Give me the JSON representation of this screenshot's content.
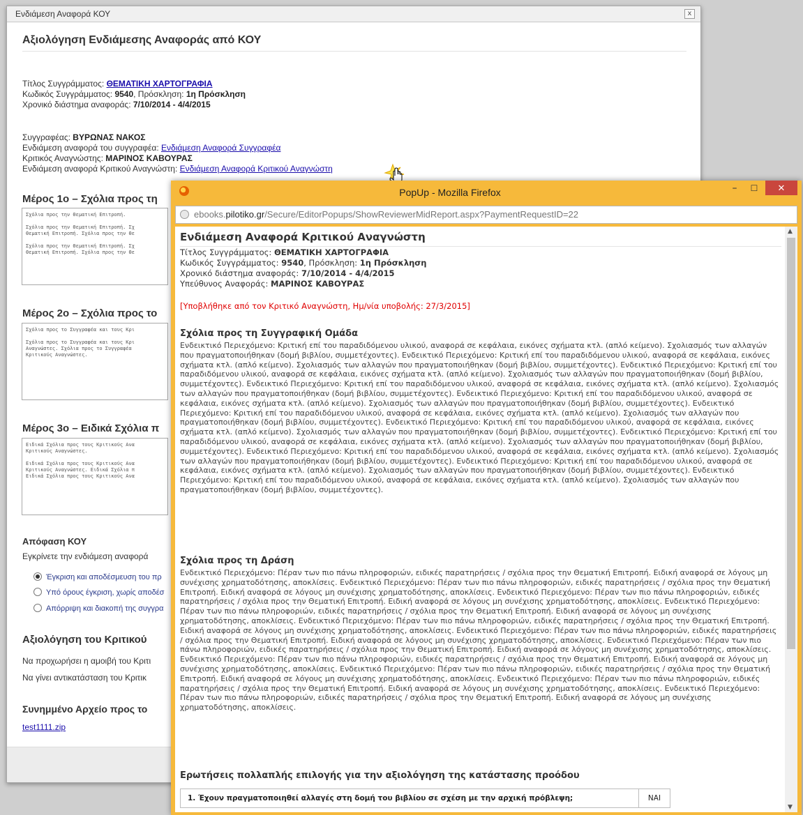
{
  "dialog": {
    "title": "Ενδιάμεση Αναφορά ΚΟΥ",
    "close": "x",
    "heading": "Αξιολόγηση Ενδιάμεσης Αναφοράς από ΚΟΥ",
    "book_title_label": "Τίτλος Συγγράμματος:",
    "book_title": "ΘΕΜΑΤΙΚΗ ΧΑΡΤΟΓΡΑΦΙΑ",
    "code_label": "Κωδικός Συγγράμματος:",
    "code": "9540",
    "call_label": ", Πρόσκληση:",
    "call": "1η Πρόσκληση",
    "period_label": "Χρονικό διάστημα αναφοράς:",
    "period": "7/10/2014 - 4/4/2015",
    "author_label": "Συγγραφέας:",
    "author": "ΒΥΡΩΝΑΣ ΝΑΚΟΣ",
    "author_report_label": "Ενδιάμεση αναφορά του συγγραφέα:",
    "author_report_link": "Ενδιάμεση Αναφορά Συγγραφέα",
    "reviewer_label": "Κριτικός Αναγνώστης:",
    "reviewer": "ΜΑΡΙΝΟΣ ΚΑΒΟΥΡΑΣ",
    "reviewer_report_label": "Ενδιάμεση αναφορά Κριτικού Αναγνώστη:",
    "reviewer_report_link": "Ενδιάμεση Αναφορά Κριτικού Αναγνώστη",
    "part1_title": "Μέρος 1ο – Σχόλια προς τη",
    "part1_text": "Σχόλια προς την Θεματική Επιτροπή.\n\nΣχόλια προς την Θεματική Επιτροπή. Σχ\nΘεματική Επιτροπή. Σχόλια προς την Θε\n\nΣχόλια προς την Θεματική Επιτροπή. Σχ\nΘεματική Επιτροπή. Σχόλια προς την Θε",
    "part2_title": "Μέρος 2ο – Σχόλια προς το",
    "part2_text": "Σχόλια προς το Συγγραφέα και τους Κρι\n\nΣχόλια προς το Συγγραφέα και τους Κρι\nΑναγνώστες. Σχόλια προς το Συγγραφέα \nΚριτικούς Αναγνώστες.",
    "part3_title": "Μέρος 3ο – Ειδικά Σχόλια π",
    "part3_text": "Ειδικά Σχόλια προς τους Κριτικούς Ανα\nΚριτικούς Αναγνώστες.\n\nΕιδικά Σχόλια προς τους Κριτικούς Ανα\nΚριτικούς Αναγνώστες. Ειδικά Σχόλια π\nΕιδικά Σχόλια προς τους Κριτικούς Ανα",
    "decision_title": "Απόφαση ΚΟΥ",
    "decision_question": "Εγκρίνετε την ενδιάμεση αναφορά",
    "radio1": "Έγκριση και αποδέσμευση του πρ",
    "radio2": "Υπό όρους έγκριση, χωρίς αποδέσ",
    "radio3": "Απόρριψη και διακοπή της συγγρα",
    "eval_title": "Αξιολόγηση του Κριτικού",
    "eval_line1": "Να προχωρήσει η αμοιβή του Κριτι",
    "eval_line2": "Να γίνει αντικατάσταση του Κριτικ",
    "attach_title": "Συνημμένο Αρχείο προς το",
    "attach_link": "test1111.zip"
  },
  "popup": {
    "window_title": "PopUp - Mozilla Firefox",
    "min": "–",
    "max": "☐",
    "close": "✕",
    "url_prefix": "ebooks.",
    "url_domain": "pilotiko.gr",
    "url_rest": "/Secure/EditorPopups/ShowReviewerMidReport.aspx?PaymentRequestID=22",
    "heading": "Ενδιάμεση Αναφορά Κριτικού Αναγνώστη",
    "title_label": "Τίτλος Συγγράμματος:",
    "title": "ΘΕΜΑΤΙΚΗ ΧΑΡΤΟΓΡΑΦΙΑ",
    "code_label": "Κωδικός Συγγράμματος:",
    "code": "9540",
    "call_label": ", Πρόσκληση:",
    "call": "1η Πρόσκληση",
    "period_label": "Χρονικό διάστημα αναφοράς:",
    "period": "7/10/2014 - 4/4/2015",
    "owner_label": "Υπεύθυνος Αναφοράς:",
    "owner": "ΜΑΡΙΝΟΣ ΚΑΒΟΥΡΑΣ",
    "submitted": "[Υποβλήθηκε από τον Κριτικό Αναγνώστη, Ημ/νία υποβολής: 27/3/2015]",
    "sec1_title": "Σχόλια προς τη Συγγραφική Ομάδα",
    "sec1_text": "Ενδεικτικό Περιεχόμενο: Κριτική επί του παραδιδόμενου υλικού, αναφορά σε κεφάλαια, εικόνες σχήματα κτλ. (απλό κείμενο). Σχολιασμός των αλλαγών που πραγματοποιήθηκαν (δομή βιβλίου, συμμετέχοντες). Ενδεικτικό Περιεχόμενο: Κριτική επί του παραδιδόμενου υλικού, αναφορά σε κεφάλαια, εικόνες σχήματα κτλ. (απλό κείμενο). Σχολιασμός των αλλαγών που πραγματοποιήθηκαν (δομή βιβλίου, συμμετέχοντες). Ενδεικτικό Περιεχόμενο: Κριτική επί του παραδιδόμενου υλικού, αναφορά σε κεφάλαια, εικόνες σχήματα κτλ. (απλό κείμενο). Σχολιασμός των αλλαγών που πραγματοποιήθηκαν (δομή βιβλίου, συμμετέχοντες). Ενδεικτικό Περιεχόμενο: Κριτική επί του παραδιδόμενου υλικού, αναφορά σε κεφάλαια, εικόνες σχήματα κτλ. (απλό κείμενο). Σχολιασμός των αλλαγών που πραγματοποιήθηκαν (δομή βιβλίου, συμμετέχοντες). Ενδεικτικό Περιεχόμενο: Κριτική επί του παραδιδόμενου υλικού, αναφορά σε κεφάλαια, εικόνες σχήματα κτλ. (απλό κείμενο). Σχολιασμός των αλλαγών που πραγματοποιήθηκαν (δομή βιβλίου, συμμετέχοντες). Ενδεικτικό Περιεχόμενο: Κριτική επί του παραδιδόμενου υλικού, αναφορά σε κεφάλαια, εικόνες σχήματα κτλ. (απλό κείμενο). Σχολιασμός των αλλαγών που πραγματοποιήθηκαν (δομή βιβλίου, συμμετέχοντες). Ενδεικτικό Περιεχόμενο: Κριτική επί του παραδιδόμενου υλικού, αναφορά σε κεφάλαια, εικόνες σχήματα κτλ. (απλό κείμενο). Σχολιασμός των αλλαγών που πραγματοποιήθηκαν (δομή βιβλίου, συμμετέχοντες). Ενδεικτικό Περιεχόμενο: Κριτική επί του παραδιδόμενου υλικού, αναφορά σε κεφάλαια, εικόνες σχήματα κτλ. (απλό κείμενο). Σχολιασμός των αλλαγών που πραγματοποιήθηκαν (δομή βιβλίου, συμμετέχοντες). Ενδεικτικό Περιεχόμενο: Κριτική επί του παραδιδόμενου υλικού, αναφορά σε κεφάλαια, εικόνες σχήματα κτλ. (απλό κείμενο). Σχολιασμός των αλλαγών που πραγματοποιήθηκαν (δομή βιβλίου, συμμετέχοντες). Ενδεικτικό Περιεχόμενο: Κριτική επί του παραδιδόμενου υλικού, αναφορά σε κεφάλαια, εικόνες σχήματα κτλ. (απλό κείμενο). Σχολιασμός των αλλαγών που πραγματοποιήθηκαν (δομή βιβλίου, συμμετέχοντες). Ενδεικτικό Περιεχόμενο: Κριτική επί του παραδιδόμενου υλικού, αναφορά σε κεφάλαια, εικόνες σχήματα κτλ. (απλό κείμενο). Σχολιασμός των αλλαγών που πραγματοποιήθηκαν (δομή βιβλίου, συμμετέχοντες).",
    "sec2_title": "Σχόλια προς τη Δράση",
    "sec2_text": "Ενδεικτικό Περιεχόμενο: Πέραν των πιο πάνω πληροφοριών, ειδικές παρατηρήσεις / σχόλια προς την Θεματική Επιτροπή. Ειδική αναφορά σε λόγους μη συνέχισης χρηματοδότησης, αποκλίσεις. Ενδεικτικό Περιεχόμενο: Πέραν των πιο πάνω πληροφοριών, ειδικές παρατηρήσεις / σχόλια προς την Θεματική Επιτροπή. Ειδική αναφορά σε λόγους μη συνέχισης χρηματοδότησης, αποκλίσεις. Ενδεικτικό Περιεχόμενο: Πέραν των πιο πάνω πληροφοριών, ειδικές παρατηρήσεις / σχόλια προς την Θεματική Επιτροπή. Ειδική αναφορά σε λόγους μη συνέχισης χρηματοδότησης, αποκλίσεις. Ενδεικτικό Περιεχόμενο: Πέραν των πιο πάνω πληροφοριών, ειδικές παρατηρήσεις / σχόλια προς την Θεματική Επιτροπή. Ειδική αναφορά σε λόγους μη συνέχισης χρηματοδότησης, αποκλίσεις. Ενδεικτικό Περιεχόμενο: Πέραν των πιο πάνω πληροφοριών, ειδικές παρατηρήσεις / σχόλια προς την Θεματική Επιτροπή. Ειδική αναφορά σε λόγους μη συνέχισης χρηματοδότησης, αποκλίσεις. Ενδεικτικό Περιεχόμενο: Πέραν των πιο πάνω πληροφοριών, ειδικές παρατηρήσεις / σχόλια προς την Θεματική Επιτροπή. Ειδική αναφορά σε λόγους μη συνέχισης χρηματοδότησης, αποκλίσεις. Ενδεικτικό Περιεχόμενο: Πέραν των πιο πάνω πληροφοριών, ειδικές παρατηρήσεις / σχόλια προς την Θεματική Επιτροπή. Ειδική αναφορά σε λόγους μη συνέχισης χρηματοδότησης, αποκλίσεις. Ενδεικτικό Περιεχόμενο: Πέραν των πιο πάνω πληροφοριών, ειδικές παρατηρήσεις / σχόλια προς την Θεματική Επιτροπή. Ειδική αναφορά σε λόγους μη συνέχισης χρηματοδότησης, αποκλίσεις. Ενδεικτικό Περιεχόμενο: Πέραν των πιο πάνω πληροφοριών, ειδικές παρατηρήσεις / σχόλια προς την Θεματική Επιτροπή. Ειδική αναφορά σε λόγους μη συνέχισης χρηματοδότησης, αποκλίσεις. Ενδεικτικό Περιεχόμενο: Πέραν των πιο πάνω πληροφοριών, ειδικές παρατηρήσεις / σχόλια προς την Θεματική Επιτροπή. Ειδική αναφορά σε λόγους μη συνέχισης χρηματοδότησης, αποκλίσεις. Ενδεικτικό Περιεχόμενο: Πέραν των πιο πάνω πληροφοριών, ειδικές παρατηρήσεις / σχόλια προς την Θεματική Επιτροπή. Ειδική αναφορά σε λόγους μη συνέχισης χρηματοδότησης, αποκλίσεις.",
    "sec3_title": "Ερωτήσεις πολλαπλής επιλογής για την αξιολόγηση της κατάστασης προόδου",
    "q1": "1. Έχουν πραγματοποιηθεί αλλαγές στη δομή του βιβλίου σε σχέση με την αρχική πρόβλεψη;",
    "q1_answer": "ΝΑΙ"
  }
}
